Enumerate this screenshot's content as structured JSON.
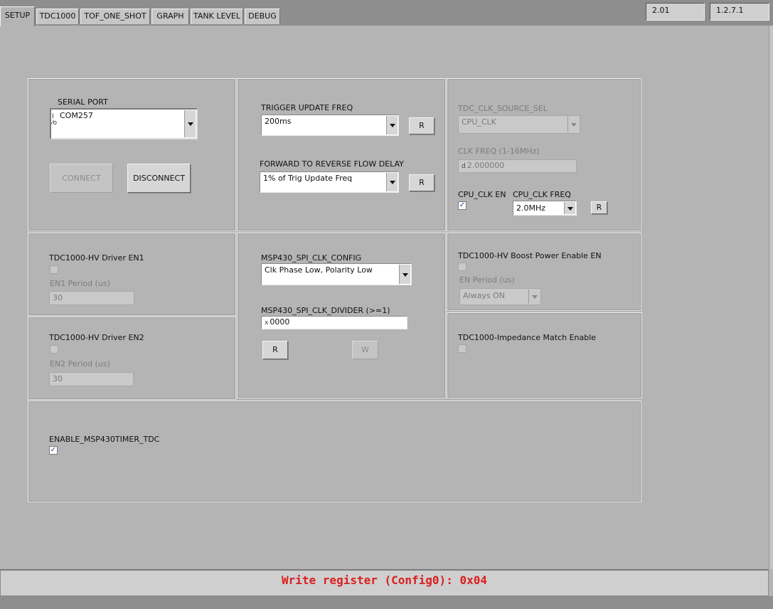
{
  "tabs": [
    {
      "label": "SETUP"
    },
    {
      "label": "TDC1000"
    },
    {
      "label": "TOF_ONE_SHOT"
    },
    {
      "label": "GRAPH"
    },
    {
      "label": "TANK LEVEL"
    },
    {
      "label": "DEBUG"
    }
  ],
  "versions": {
    "gui": "2.01",
    "firmware": "1.2.7.1"
  },
  "serial": {
    "label": "SERIAL PORT",
    "port": "COM257",
    "io_glyph": "I/O",
    "connect_label": "CONNECT",
    "disconnect_label": "DISCONNECT"
  },
  "trigger": {
    "label": "TRIGGER UPDATE FREQ",
    "value": "200ms",
    "read_label": "R"
  },
  "flow_delay": {
    "label": "FORWARD TO REVERSE FLOW DELAY",
    "value": "1% of Trig Update Freq",
    "read_label": "R"
  },
  "clk_source": {
    "label": "TDC_CLK_SOURCE_SEL",
    "value": "CPU_CLK",
    "freq_label": "CLK FREQ (1-16MHz)",
    "freq_radix": "d",
    "freq_value": "2.000000",
    "cpu_clk_en_label": "CPU_CLK EN",
    "cpu_clk_en_mark": "✓",
    "cpu_clk_freq_label": "CPU_CLK FREQ",
    "cpu_clk_freq_value": "2.0MHz",
    "read_label": "R"
  },
  "driver_en1": {
    "label": "TDC1000-HV Driver EN1",
    "period_label": "EN1 Period (us)",
    "period_value": "30"
  },
  "driver_en2": {
    "label": "TDC1000-HV Driver EN2",
    "period_label": "EN2 Period (us)",
    "period_value": "30"
  },
  "spi": {
    "config_label": "MSP430_SPI_CLK_CONFIG",
    "config_value": "Clk Phase Low, Polarity Low",
    "divider_label": "MSP430_SPI_CLK_DIVIDER (>=1)",
    "divider_radix": "x",
    "divider_value": "0000",
    "read_label": "R",
    "write_label": "W"
  },
  "boost": {
    "label": "TDC1000-HV Boost Power Enable EN",
    "period_label": "EN Period (us)",
    "period_value": "Always ON"
  },
  "impedance": {
    "label": "TDC1000-Impedance Match Enable"
  },
  "timer": {
    "label": "ENABLE_MSP430TIMER_TDC",
    "mark": "✓"
  },
  "status": {
    "message": "Write register (Config0): 0x04",
    "color": "#dc1e1e"
  }
}
